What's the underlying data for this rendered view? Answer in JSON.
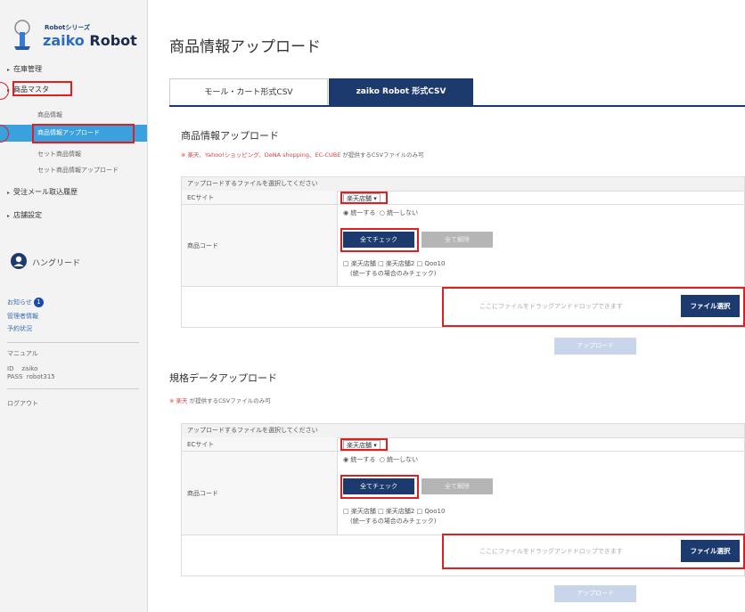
{
  "sidebar": {
    "logo_small": "Robotシリーズ",
    "logo_word1": "zaiko",
    "logo_word2": "Robot",
    "nav": [
      {
        "label": "在庫管理"
      },
      {
        "label": "商品マスタ"
      }
    ],
    "sub_items": [
      "商品情報",
      "商品情報アップロード",
      "セット商品情報",
      "セット商品情報アップロード"
    ],
    "nav2": [
      {
        "label": "受注メール取込履歴"
      },
      {
        "label": "店舗設定"
      }
    ],
    "user_name": "ハングリード",
    "links": [
      "お知らせ",
      "管理者情報",
      "予約状況"
    ],
    "notice_count": "1",
    "manual": "マニュアル",
    "id_label": "ID",
    "id_value": "zaiko",
    "pass_label": "PASS",
    "pass_value": "robot315",
    "logout": "ログアウト",
    "colors": {
      "active_bg": "#3aa0de",
      "highlight": "#e02020"
    }
  },
  "main": {
    "title": "商品情報アップロード",
    "tabs": [
      {
        "label": "モール・カート形式CSV",
        "active": false
      },
      {
        "label": "zaiko Robot 形式CSV",
        "active": true
      }
    ],
    "section1": {
      "title": "商品情報アップロード",
      "note_red": "※ 楽天、Yahoo!ショッピング、DeNA shopping、EC-CUBE",
      "note_gray": "が提供するCSVファイルのみ可",
      "header": "アップロードするファイルを選択してください",
      "ec_label": "ECサイト",
      "ec_value": "楽天店舗",
      "code_label": "商品コード",
      "radio_unify": "統一する",
      "radio_not_unify": "統一しない",
      "check_all": "全てチェック",
      "uncheck_all": "全て解除",
      "shops": "楽天店舗 □ 楽天店舗2 □ Qoo10",
      "shops_note": "(統一するの場合のみチェック)",
      "drop_placeholder": "ここにファイルをドラッグアンドドロップできます",
      "file_button": "ファイル選択",
      "upload_button": "アップロード"
    },
    "section2": {
      "title": "規格データアップロード",
      "note_red": "※ 楽天",
      "note_gray": "が提供するCSVファイルのみ可",
      "header": "アップロードするファイルを選択してください",
      "ec_label": "ECサイト",
      "ec_value": "楽天店舗",
      "code_label": "商品コード",
      "radio_unify": "統一する",
      "radio_not_unify": "統一しない",
      "check_all": "全てチェック",
      "uncheck_all": "全て解除",
      "shops": "楽天店舗 □ 楽天店舗2 □ Qoo10",
      "shops_note": "(統一するの場合のみチェック)",
      "drop_placeholder": "ここにファイルをドラッグアンドドロップできます",
      "file_button": "ファイル選択",
      "upload_button": "アップロード"
    },
    "colors": {
      "navy": "#1c3a6e",
      "red": "#e04040"
    }
  }
}
